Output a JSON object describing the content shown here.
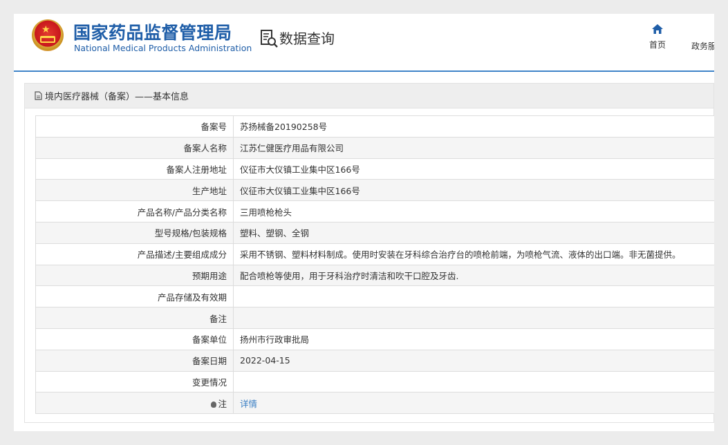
{
  "header": {
    "brand_cn": "国家药品监督管理局",
    "brand_en": "National Medical Products Administration",
    "query_title": "数据查询",
    "nav": {
      "home_label": "首页",
      "gov_label": "政务服"
    },
    "accent_color": "#1f5ea8"
  },
  "panel": {
    "title": "境内医疗器械（备案）——基本信息"
  },
  "rows": [
    {
      "label": "备案号",
      "value": "苏扬械备20190258号"
    },
    {
      "label": "备案人名称",
      "value": "江苏仁健医疗用品有限公司"
    },
    {
      "label": "备案人注册地址",
      "value": "仪征市大仪镇工业集中区166号"
    },
    {
      "label": "生产地址",
      "value": "仪征市大仪镇工业集中区166号"
    },
    {
      "label": "产品名称/产品分类名称",
      "value": "三用喷枪枪头"
    },
    {
      "label": "型号规格/包装规格",
      "value": "塑料、塑钢、全钢"
    },
    {
      "label": "产品描述/主要组成成分",
      "value": "采用不锈钢、塑料材料制成。使用时安装在牙科综合治疗台的喷枪前端，为喷枪气流、液体的出口端。非无菌提供。"
    },
    {
      "label": "预期用途",
      "value": "配合喷枪等使用，用于牙科治疗时清洁和吹干口腔及牙齿."
    },
    {
      "label": "产品存储及有效期",
      "value": ""
    },
    {
      "label": "备注",
      "value": ""
    },
    {
      "label": "备案单位",
      "value": "扬州市行政审批局"
    },
    {
      "label": "备案日期",
      "value": "2022-04-15"
    },
    {
      "label": "变更情况",
      "value": ""
    }
  ],
  "note_row": {
    "label": "注",
    "link_text": "详情"
  }
}
